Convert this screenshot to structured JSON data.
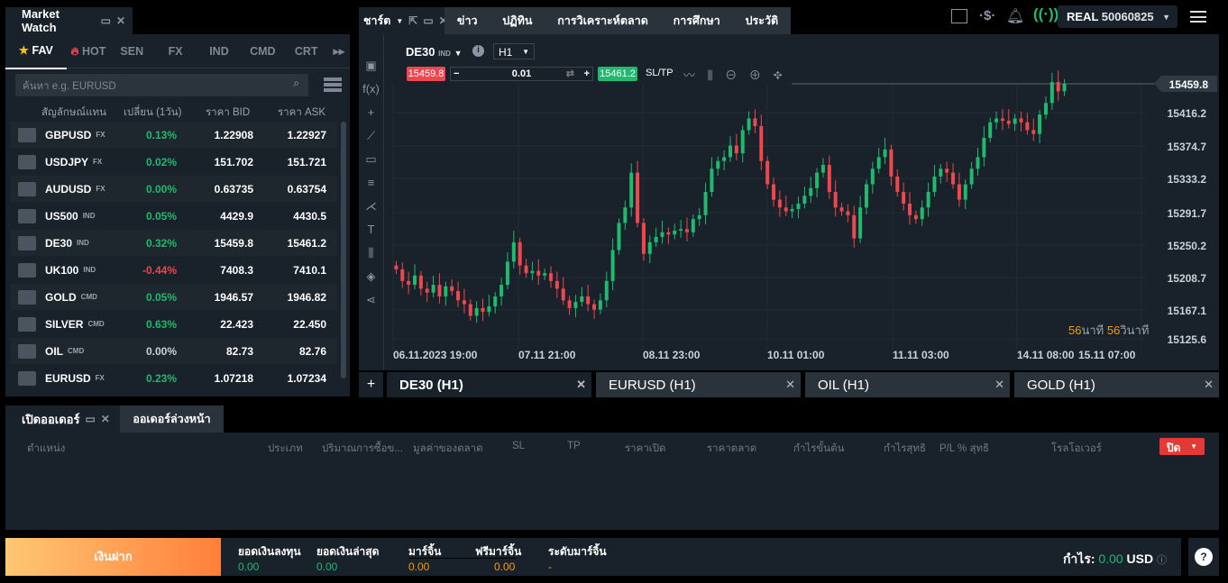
{
  "market_watch": {
    "title": "Market Watch",
    "tabs": [
      "FAV",
      "HOT",
      "SEN",
      "FX",
      "IND",
      "CMD",
      "CRT"
    ],
    "search_placeholder": "ค้นหา e.g. EURUSD",
    "columns": [
      "สัญลักษณ์แทน",
      "เปลี่ยน (1วัน)",
      "ราคา BID",
      "ราคา ASK"
    ],
    "rows": [
      {
        "symbol": "GBPUSD",
        "type": "FX",
        "change": "0.13%",
        "dir": "up",
        "bid": "1.22908",
        "ask": "1.22927"
      },
      {
        "symbol": "USDJPY",
        "type": "FX",
        "change": "0.02%",
        "dir": "up",
        "bid": "151.702",
        "ask": "151.721"
      },
      {
        "symbol": "AUDUSD",
        "type": "FX",
        "change": "0.00%",
        "dir": "up",
        "bid": "0.63735",
        "ask": "0.63754"
      },
      {
        "symbol": "US500",
        "type": "IND",
        "change": "0.05%",
        "dir": "up",
        "bid": "4429.9",
        "ask": "4430.5"
      },
      {
        "symbol": "DE30",
        "type": "IND",
        "change": "0.32%",
        "dir": "up",
        "bid": "15459.8",
        "ask": "15461.2"
      },
      {
        "symbol": "UK100",
        "type": "IND",
        "change": "-0.44%",
        "dir": "dn",
        "bid": "7408.3",
        "ask": "7410.1"
      },
      {
        "symbol": "GOLD",
        "type": "CMD",
        "change": "0.05%",
        "dir": "up",
        "bid": "1946.57",
        "ask": "1946.82"
      },
      {
        "symbol": "SILVER",
        "type": "CMD",
        "change": "0.63%",
        "dir": "up",
        "bid": "22.423",
        "ask": "22.450"
      },
      {
        "symbol": "OIL",
        "type": "CMD",
        "change": "0.00%",
        "dir": "zero",
        "bid": "82.73",
        "ask": "82.76"
      },
      {
        "symbol": "EURUSD",
        "type": "FX",
        "change": "0.23%",
        "dir": "up",
        "bid": "1.07218",
        "ask": "1.07234"
      }
    ]
  },
  "nav": {
    "chart": "ชาร์ต",
    "items": [
      "ข่าว",
      "ปฏิทิน",
      "การวิเคราะห์ตลาด",
      "การศึกษา",
      "ประวัติ"
    ],
    "account_type": "REAL",
    "account_number": "50060825"
  },
  "chart": {
    "symbol": "DE30",
    "symbol_type": "IND",
    "timeframe": "H1",
    "sell": "15459.8",
    "lot": "0.01",
    "buy": "15461.2",
    "sltp": "SL/TP",
    "countdown": {
      "min": "56",
      "min_label": "นาที",
      "sec": "56",
      "sec_label": "วินาที"
    },
    "tabs": [
      "DE30 (H1)",
      "EURUSD (H1)",
      "OIL (H1)",
      "GOLD (H1)"
    ]
  },
  "chart_data": {
    "type": "candlestick",
    "x_ticks": [
      "06.11.2023 19:00",
      "07.11 21:00",
      "08.11 23:00",
      "10.11 01:00",
      "11.11 03:00",
      "14.11 08:00",
      "15.11 07:00"
    ],
    "y_ticks": [
      "15416.2",
      "15374.7",
      "15333.2",
      "15291.7",
      "15250.2",
      "15208.7",
      "15167.1",
      "15125.6"
    ],
    "ylim": [
      15125.6,
      15459.8
    ],
    "current_price": "15459.8",
    "grid": true,
    "up_color": "#1fba6e",
    "down_color": "#f0474e",
    "closes": [
      15220,
      15205,
      15200,
      15212,
      15195,
      15190,
      15200,
      15185,
      15198,
      15192,
      15180,
      15175,
      15160,
      15170,
      15165,
      15172,
      15185,
      15200,
      15230,
      15255,
      15225,
      15215,
      15218,
      15212,
      15215,
      15205,
      15195,
      15180,
      15170,
      15178,
      15185,
      15175,
      15168,
      15180,
      15205,
      15245,
      15280,
      15300,
      15345,
      15280,
      15240,
      15255,
      15262,
      15268,
      15265,
      15270,
      15272,
      15268,
      15285,
      15290,
      15320,
      15350,
      15360,
      15365,
      15380,
      15370,
      15400,
      15415,
      15405,
      15360,
      15330,
      15310,
      15300,
      15295,
      15298,
      15305,
      15315,
      15325,
      15345,
      15355,
      15320,
      15300,
      15295,
      15290,
      15260,
      15300,
      15330,
      15350,
      15365,
      15375,
      15340,
      15320,
      15305,
      15290,
      15285,
      15300,
      15320,
      15340,
      15350,
      15345,
      15330,
      15310,
      15330,
      15350,
      15365,
      15390,
      15410,
      15415,
      15412,
      15408,
      15415,
      15410,
      15400,
      15395,
      15420,
      15435,
      15462,
      15450,
      15459.8
    ]
  },
  "orders": {
    "tabs": [
      "เปิดออเดอร์",
      "ออเดอร์ล่วงหน้า"
    ],
    "columns": [
      "ตำแหน่ง",
      "ประเภท",
      "ปริมาณการซื้อข...",
      "มูลค่าของตลาด",
      "SL",
      "TP",
      "ราคาเปิด",
      "ราคาตลาด",
      "กำไรขั้นต้น",
      "กำไรสุทธิ",
      "P/L % สุทธิ",
      "โรลโอเวอร์"
    ],
    "close_label": "ปิด"
  },
  "footer": {
    "deposit": "เงินฝาก",
    "stats": [
      {
        "label": "ยอดเงินลงทุน",
        "value": "0.00"
      },
      {
        "label": "ยอดเงินล่าสุด",
        "value": "0.00"
      },
      {
        "label": "มาร์จิ้น",
        "value": "0.00"
      },
      {
        "label": "ฟรีมาร์จิ้น",
        "value": "0.00"
      },
      {
        "label": "ระดับมาร์จิ้น",
        "value": "-"
      }
    ],
    "profit_label": "กำไร:",
    "profit_value": "0.00",
    "currency": "USD"
  }
}
